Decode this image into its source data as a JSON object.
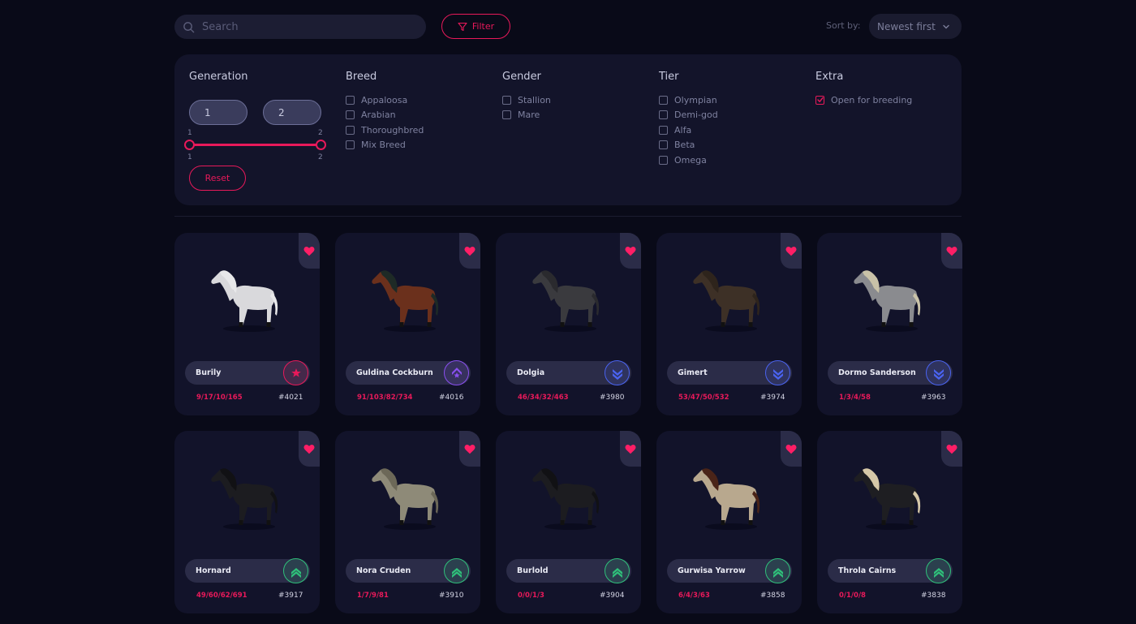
{
  "search": {
    "placeholder": "Search"
  },
  "filter_button": {
    "label": "Filter"
  },
  "sort": {
    "label": "Sort by:",
    "selected": "Newest first"
  },
  "filters": {
    "generation": {
      "title": "Generation",
      "min_value": "1",
      "max_value": "2",
      "range_min_label": "1",
      "range_max_label": "2",
      "reset_label": "Reset"
    },
    "breed": {
      "title": "Breed",
      "options": [
        {
          "label": "Appaloosa",
          "checked": false
        },
        {
          "label": "Arabian",
          "checked": false
        },
        {
          "label": "Thoroughbred",
          "checked": false
        },
        {
          "label": "Mix Breed",
          "checked": false
        }
      ]
    },
    "gender": {
      "title": "Gender",
      "options": [
        {
          "label": "Stallion",
          "checked": false
        },
        {
          "label": "Mare",
          "checked": false
        }
      ]
    },
    "tier": {
      "title": "Tier",
      "options": [
        {
          "label": "Olympian",
          "checked": false
        },
        {
          "label": "Demi-god",
          "checked": false
        },
        {
          "label": "Alfa",
          "checked": false
        },
        {
          "label": "Beta",
          "checked": false
        },
        {
          "label": "Omega",
          "checked": false
        }
      ]
    },
    "extra": {
      "title": "Extra",
      "options": [
        {
          "label": "Open for breeding",
          "checked": true
        }
      ]
    }
  },
  "colors": {
    "accent": "#e8195a",
    "background": "#090a18",
    "panel": "#13142a",
    "card": "#12132a",
    "pill": "#2b2c48"
  },
  "horses": [
    {
      "name": "Burily",
      "stats": "9/17/10/165",
      "id": "#4021",
      "tier_icon": "star-icon",
      "tier_color": "#e8195a",
      "coat": "#d9d9dc",
      "mane": "#e8e8ea"
    },
    {
      "name": "Guldina Cockburn",
      "stats": "91/103/82/734",
      "id": "#4016",
      "tier_icon": "crest-icon",
      "tier_color": "#8a4ff0",
      "coat": "#6b301c",
      "mane": "#1e2a26"
    },
    {
      "name": "Dolgia",
      "stats": "46/34/32/463",
      "id": "#3980",
      "tier_icon": "double-chevron-down-icon",
      "tier_color": "#4a63f0",
      "coat": "#3a3a3e",
      "mane": "#2a2a2e"
    },
    {
      "name": "Gimert",
      "stats": "53/47/50/532",
      "id": "#3974",
      "tier_icon": "double-chevron-down-icon",
      "tier_color": "#4a63f0",
      "coat": "#3d3026",
      "mane": "#2e241c"
    },
    {
      "name": "Dormo Sanderson",
      "stats": "1/3/4/58",
      "id": "#3963",
      "tier_icon": "double-chevron-down-icon",
      "tier_color": "#4a63f0",
      "coat": "#8a8b8f",
      "mane": "#c9c2a8"
    },
    {
      "name": "Hornard",
      "stats": "49/60/62/691",
      "id": "#3917",
      "tier_icon": "double-chevron-up-icon",
      "tier_color": "#2fc07a",
      "coat": "#1c1c20",
      "mane": "#111114"
    },
    {
      "name": "Nora Cruden",
      "stats": "1/7/9/81",
      "id": "#3910",
      "tier_icon": "double-chevron-up-icon",
      "tier_color": "#2fc07a",
      "coat": "#8e8a78",
      "mane": "#6c6858"
    },
    {
      "name": "Burlold",
      "stats": "0/0/1/3",
      "id": "#3904",
      "tier_icon": "double-chevron-up-icon",
      "tier_color": "#2fc07a",
      "coat": "#1c1c20",
      "mane": "#111114"
    },
    {
      "name": "Gurwisa Yarrow",
      "stats": "6/4/3/63",
      "id": "#3858",
      "tier_icon": "double-chevron-up-icon",
      "tier_color": "#2fc07a",
      "coat": "#b8a88e",
      "mane": "#4a2418"
    },
    {
      "name": "Throla Cairns",
      "stats": "0/1/0/8",
      "id": "#3838",
      "tier_icon": "double-chevron-up-icon",
      "tier_color": "#2fc07a",
      "coat": "#1e1e22",
      "mane": "#d6c8a8"
    }
  ]
}
